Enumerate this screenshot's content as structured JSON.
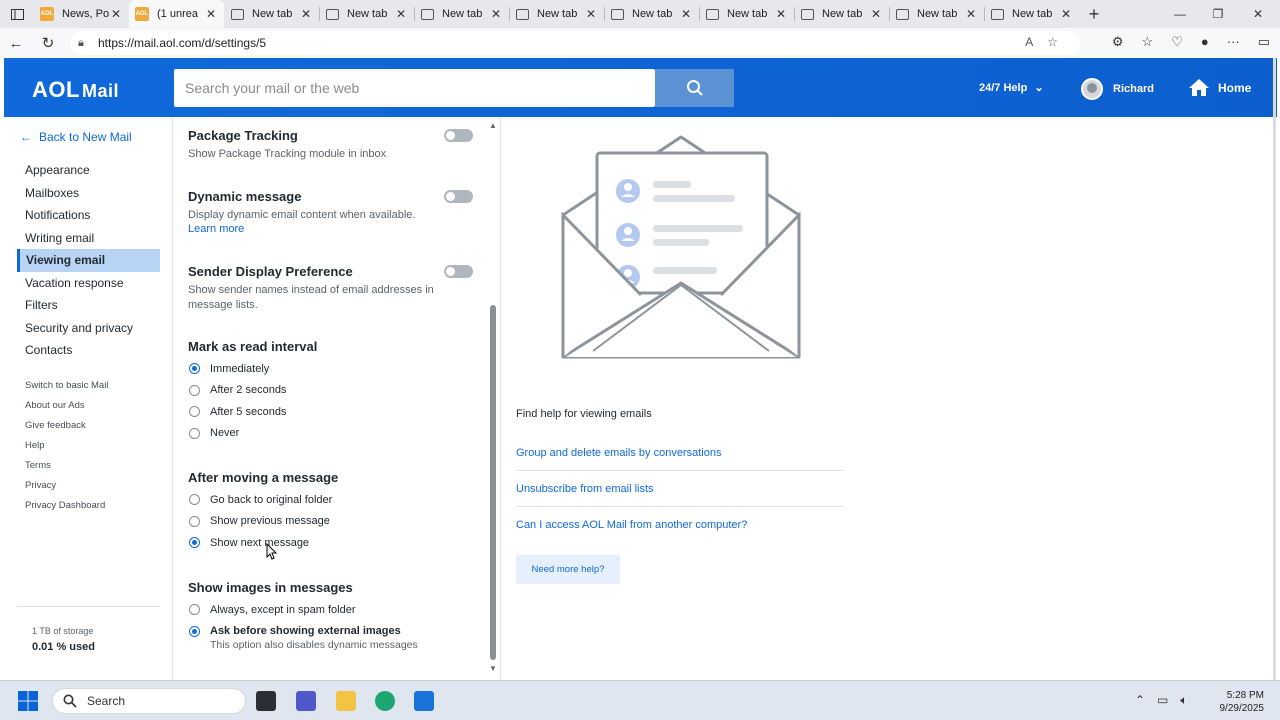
{
  "browser": {
    "tabs": [
      {
        "title": "News, Po",
        "icon": "aol-favicon",
        "active": false
      },
      {
        "title": "(1 unrea",
        "icon": "aol-favicon",
        "active": true
      },
      {
        "title": "New tab",
        "icon": "newtab-icon",
        "active": false
      },
      {
        "title": "New tab",
        "icon": "newtab-icon",
        "active": false
      },
      {
        "title": "New tab",
        "icon": "newtab-icon",
        "active": false
      },
      {
        "title": "New tab",
        "icon": "newtab-icon",
        "active": false
      },
      {
        "title": "New tab",
        "icon": "newtab-icon",
        "active": false
      },
      {
        "title": "New tab",
        "icon": "newtab-icon",
        "active": false
      },
      {
        "title": "New tab",
        "icon": "newtab-icon",
        "active": false
      },
      {
        "title": "New tab",
        "icon": "newtab-icon",
        "active": false
      },
      {
        "title": "New tab",
        "icon": "newtab-icon",
        "active": false
      }
    ],
    "favicon_text": "AOL",
    "url": "https://mail.aol.com/d/settings/5"
  },
  "header": {
    "logo": "AOL",
    "logo_suffix": "Mail",
    "search_placeholder": "Search your mail or the web",
    "help_label": "24/7 Help",
    "user_name": "Richard",
    "home_label": "Home",
    "brand_color": "#0f69da"
  },
  "sidebar": {
    "back_label": "Back to New Mail",
    "items": [
      {
        "label": "Appearance"
      },
      {
        "label": "Mailboxes"
      },
      {
        "label": "Notifications"
      },
      {
        "label": "Writing email"
      },
      {
        "label": "Viewing email",
        "active": true
      },
      {
        "label": "Vacation response"
      },
      {
        "label": "Filters"
      },
      {
        "label": "Security and privacy"
      },
      {
        "label": "Contacts"
      }
    ],
    "small_links": [
      "Switch to basic Mail",
      "About our Ads",
      "Give feedback",
      "Help",
      "Terms",
      "Privacy",
      "Privacy Dashboard"
    ],
    "storage_total": "1 TB of storage",
    "storage_used": "0.01 % used"
  },
  "settings": {
    "package_tracking": {
      "title": "Package Tracking",
      "desc": "Show Package Tracking module in inbox",
      "enabled": false
    },
    "dynamic_message": {
      "title": "Dynamic message",
      "desc": "Display dynamic email content when available.",
      "link": "Learn more",
      "enabled": false
    },
    "sender_display": {
      "title": "Sender Display Preference",
      "desc": "Show sender names instead of email addresses in message lists.",
      "enabled": false
    },
    "mark_as_read": {
      "title": "Mark as read interval",
      "options": [
        "Immediately",
        "After 2 seconds",
        "After 5 seconds",
        "Never"
      ],
      "selected": "Immediately"
    },
    "after_moving": {
      "title": "After moving a message",
      "options": [
        "Go back to original folder",
        "Show previous message",
        "Show next message"
      ],
      "selected": "Show next message"
    },
    "show_images": {
      "title": "Show images in messages",
      "options": [
        "Always, except in spam folder",
        "Ask before showing external images"
      ],
      "selected": "Ask before showing external images",
      "selected_note": "This option also disables dynamic messages"
    }
  },
  "help": {
    "title": "Find help for viewing emails",
    "links": [
      "Group and delete emails by conversations",
      "Unsubscribe from email lists",
      "Can I access AOL Mail from another computer?"
    ],
    "need_more": "Need more help?"
  },
  "taskbar": {
    "search_label": "Search",
    "time": "5:28 PM",
    "date": "9/29/2025"
  }
}
